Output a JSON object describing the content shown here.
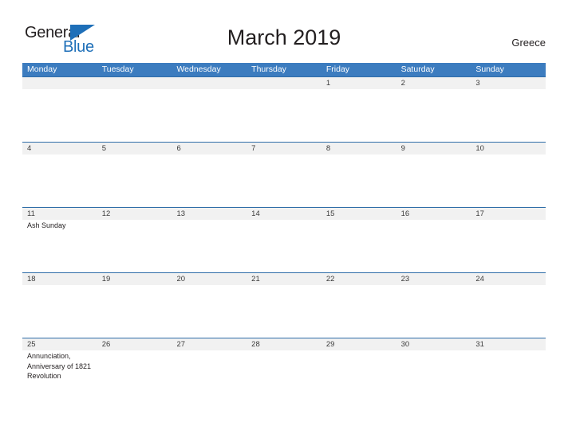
{
  "brand": {
    "name_part1": "General",
    "name_part2": "Blue",
    "flag_icon": "blue-triangle-flag",
    "color_dark": "#231f20",
    "color_blue": "#1e6fb8"
  },
  "header": {
    "title": "March 2019",
    "country": "Greece"
  },
  "calendar": {
    "header_color": "#3c7cbf",
    "number_band_color": "#f1f1f1",
    "rule_color": "#2f6da8",
    "weekdays": [
      "Monday",
      "Tuesday",
      "Wednesday",
      "Thursday",
      "Friday",
      "Saturday",
      "Sunday"
    ],
    "weeks": [
      {
        "days": [
          {
            "num": "",
            "event": ""
          },
          {
            "num": "",
            "event": ""
          },
          {
            "num": "",
            "event": ""
          },
          {
            "num": "",
            "event": ""
          },
          {
            "num": "1",
            "event": ""
          },
          {
            "num": "2",
            "event": ""
          },
          {
            "num": "3",
            "event": ""
          }
        ]
      },
      {
        "days": [
          {
            "num": "4",
            "event": ""
          },
          {
            "num": "5",
            "event": ""
          },
          {
            "num": "6",
            "event": ""
          },
          {
            "num": "7",
            "event": ""
          },
          {
            "num": "8",
            "event": ""
          },
          {
            "num": "9",
            "event": ""
          },
          {
            "num": "10",
            "event": ""
          }
        ]
      },
      {
        "days": [
          {
            "num": "11",
            "event": "Ash Sunday"
          },
          {
            "num": "12",
            "event": ""
          },
          {
            "num": "13",
            "event": ""
          },
          {
            "num": "14",
            "event": ""
          },
          {
            "num": "15",
            "event": ""
          },
          {
            "num": "16",
            "event": ""
          },
          {
            "num": "17",
            "event": ""
          }
        ]
      },
      {
        "days": [
          {
            "num": "18",
            "event": ""
          },
          {
            "num": "19",
            "event": ""
          },
          {
            "num": "20",
            "event": ""
          },
          {
            "num": "21",
            "event": ""
          },
          {
            "num": "22",
            "event": ""
          },
          {
            "num": "23",
            "event": ""
          },
          {
            "num": "24",
            "event": ""
          }
        ]
      },
      {
        "days": [
          {
            "num": "25",
            "event": "Annunciation, Anniversary of 1821 Revolution"
          },
          {
            "num": "26",
            "event": ""
          },
          {
            "num": "27",
            "event": ""
          },
          {
            "num": "28",
            "event": ""
          },
          {
            "num": "29",
            "event": ""
          },
          {
            "num": "30",
            "event": ""
          },
          {
            "num": "31",
            "event": ""
          }
        ]
      }
    ]
  }
}
